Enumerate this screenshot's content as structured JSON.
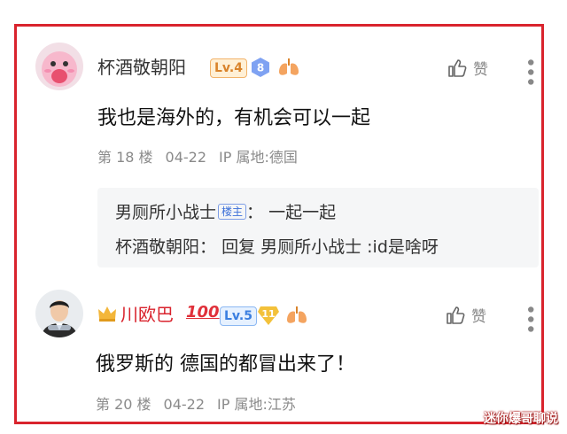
{
  "comments": [
    {
      "username": "杯酒敬朝阳",
      "level": "Lv.4",
      "fan_badge": "8",
      "like_label": "赞",
      "text": "我也是海外的，有机会可以一起",
      "floor": "第 18 楼",
      "date": "04-22",
      "location": "IP 属地:德国",
      "replies": [
        {
          "author": "男厕所小战士",
          "tag": "楼主",
          "sep": "：",
          "text": "一起一起"
        },
        {
          "author": "杯酒敬朝阳",
          "tag": "",
          "sep": "：",
          "text": "回复 男厕所小战士 :id是啥呀"
        }
      ]
    },
    {
      "username": "川欧巴",
      "level": "Lv.5",
      "fan_badge": "11",
      "like_label": "赞",
      "text": "俄罗斯的 德国的都冒出来了！",
      "floor": "第 20 楼",
      "date": "04-22",
      "location": "IP 属地:江苏"
    }
  ],
  "watermark": "迷你爆哥聊说",
  "colors": {
    "frame": "#d9232d",
    "username_vip": "#d9232d",
    "meta": "#8a8a8a"
  }
}
